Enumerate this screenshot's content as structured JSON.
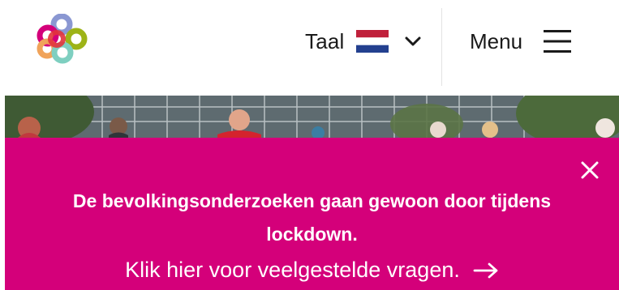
{
  "header": {
    "language_label": "Taal",
    "menu_label": "Menu"
  },
  "banner": {
    "message": "De bevolkingsonderzoeken gaan gewoon door tijdens lockdown.",
    "link_text": "Klik hier voor veelgestelde vragen."
  },
  "icons": {
    "logo": "colored-rings-logo",
    "flag": "netherlands-flag-icon",
    "language_dropdown": "chevron-down-icon",
    "menu": "hamburger-icon",
    "close": "close-icon",
    "link_arrow": "arrow-right-icon"
  },
  "colors": {
    "banner_background": "#d4007a",
    "banner_text": "#ffffff",
    "header_text": "#1a1a1a"
  }
}
